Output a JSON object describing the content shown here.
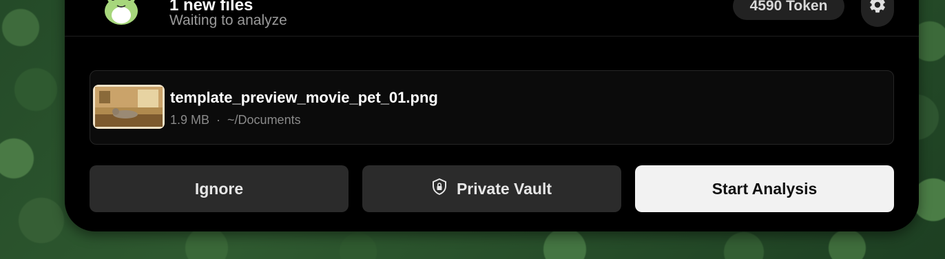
{
  "header": {
    "title": "1 new files",
    "subtitle": "Waiting to analyze",
    "token_badge": "4590 Token",
    "settings_icon": "gear-icon",
    "mascot_icon": "frog-icon"
  },
  "file": {
    "name": "template_preview_movie_pet_01.png",
    "size": "1.9 MB",
    "separator": "·",
    "location": "~/Documents",
    "thumbnail_icon": "image-thumbnail"
  },
  "actions": {
    "ignore_label": "Ignore",
    "vault_label": "Private Vault",
    "vault_icon": "shield-lock-icon",
    "start_label": "Start Analysis"
  },
  "colors": {
    "panel_bg": "#000000",
    "secondary_button_bg": "#2b2b2b",
    "primary_button_bg": "#f2f2f2",
    "muted_text": "#9a9a9a"
  }
}
